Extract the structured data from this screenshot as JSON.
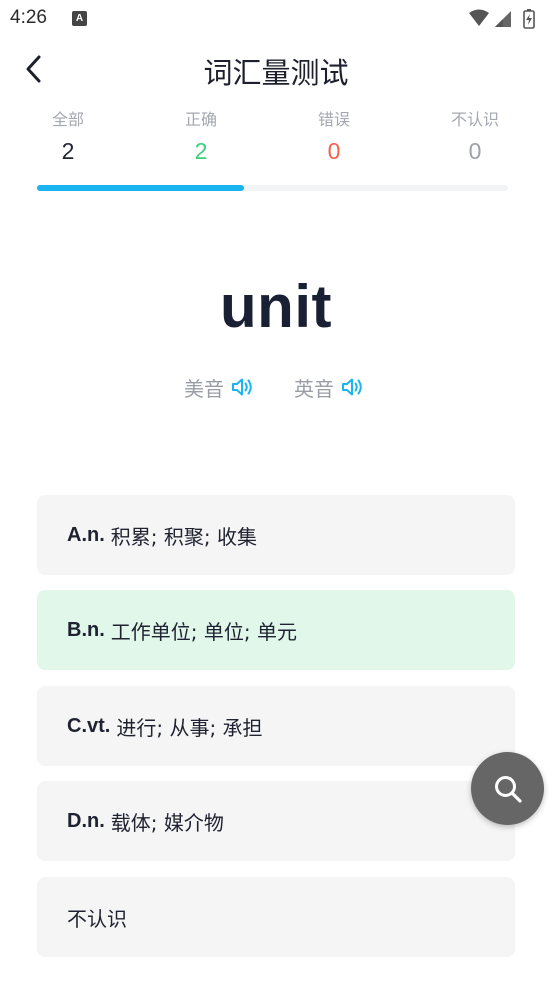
{
  "status_bar": {
    "time": "4:26",
    "notification_icon": "A",
    "icons": [
      "wifi-icon",
      "cell-signal-icon",
      "battery-charging-icon"
    ]
  },
  "header": {
    "back_icon": "chevron-left-icon",
    "title": "词汇量测试"
  },
  "stats": [
    {
      "label": "全部",
      "value": "2"
    },
    {
      "label": "正确",
      "value": "2"
    },
    {
      "label": "错误",
      "value": "0"
    },
    {
      "label": "不认识",
      "value": "0"
    }
  ],
  "progress": {
    "fraction": 0.44
  },
  "word": "unit",
  "pronunciations": [
    {
      "label": "美音",
      "icon": "speaker-icon"
    },
    {
      "label": "英音",
      "icon": "speaker-icon"
    }
  ],
  "options": [
    {
      "prefix": "A.n.",
      "text": "积累; 积聚; 收集",
      "state": "default"
    },
    {
      "prefix": "B.n.",
      "text": "工作单位; 单位; 单元",
      "state": "correct"
    },
    {
      "prefix": "C.vt.",
      "text": "进行; 从事; 承担",
      "state": "default"
    },
    {
      "prefix": "D.n.",
      "text": "载体; 媒介物",
      "state": "default"
    },
    {
      "prefix": "",
      "text": "不认识",
      "state": "default"
    }
  ],
  "fab": {
    "icon": "search-icon"
  },
  "colors": {
    "accent": "#1ab4f0",
    "correct": "#3dcf79",
    "wrong": "#f0614f",
    "correct_bg": "#e0f7ea",
    "option_bg": "#f5f5f5"
  }
}
